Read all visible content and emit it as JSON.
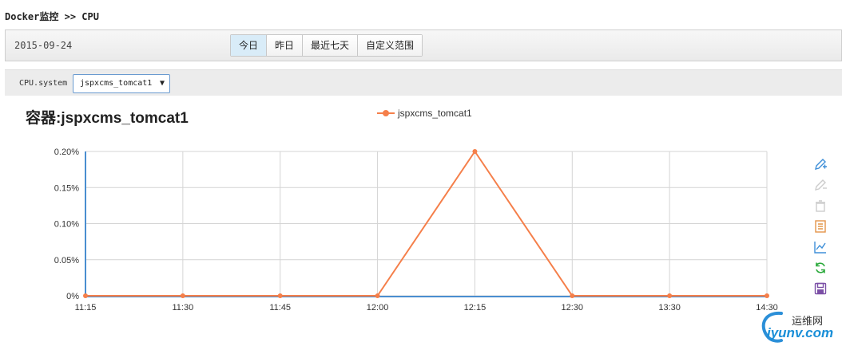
{
  "breadcrumb": {
    "root": "Docker监控",
    "sep": ">>",
    "current": "CPU"
  },
  "toolbar": {
    "date": "2015-09-24",
    "ranges": [
      {
        "label": "今日",
        "active": true
      },
      {
        "label": "昨日",
        "active": false
      },
      {
        "label": "最近七天",
        "active": false
      },
      {
        "label": "自定义范围",
        "active": false
      }
    ]
  },
  "filter": {
    "label": "CPU.system",
    "selected": "jspxcms_tomcat1",
    "caret": "▼"
  },
  "chart": {
    "title": "容器:jspxcms_tomcat1"
  },
  "watermark": {
    "cn": "运维网",
    "en": "iyunv.com"
  },
  "colors": {
    "series": "#f57f4a",
    "axis": "#4a8ed0",
    "grid": "#d4d4d4",
    "accent": "#2b8fd8"
  },
  "tools": [
    {
      "name": "mark-icon",
      "color": "#3e8fd8"
    },
    {
      "name": "mark-undo-icon",
      "color": "#cccccc"
    },
    {
      "name": "mark-clear-icon",
      "color": "#cccccc"
    },
    {
      "name": "data-view-icon",
      "color": "#e49549"
    },
    {
      "name": "line-chart-icon",
      "color": "#3e8fd8"
    },
    {
      "name": "restore-icon",
      "color": "#29a93a"
    },
    {
      "name": "save-image-icon",
      "color": "#7b4fa6"
    }
  ],
  "chart_data": {
    "type": "line",
    "categories": [
      "11:15",
      "11:30",
      "11:45",
      "12:00",
      "12:15",
      "12:30",
      "13:30",
      "14:30"
    ],
    "series": [
      {
        "name": "jspxcms_tomcat1",
        "values": [
          0,
          0,
          0,
          0,
          0.2,
          0,
          0,
          0
        ]
      }
    ],
    "y_ticks": [
      "0%",
      "0.05%",
      "0.10%",
      "0.15%",
      "0.20%"
    ],
    "ylim": [
      0,
      0.2
    ],
    "grid": true,
    "legend_position": "top-center"
  }
}
